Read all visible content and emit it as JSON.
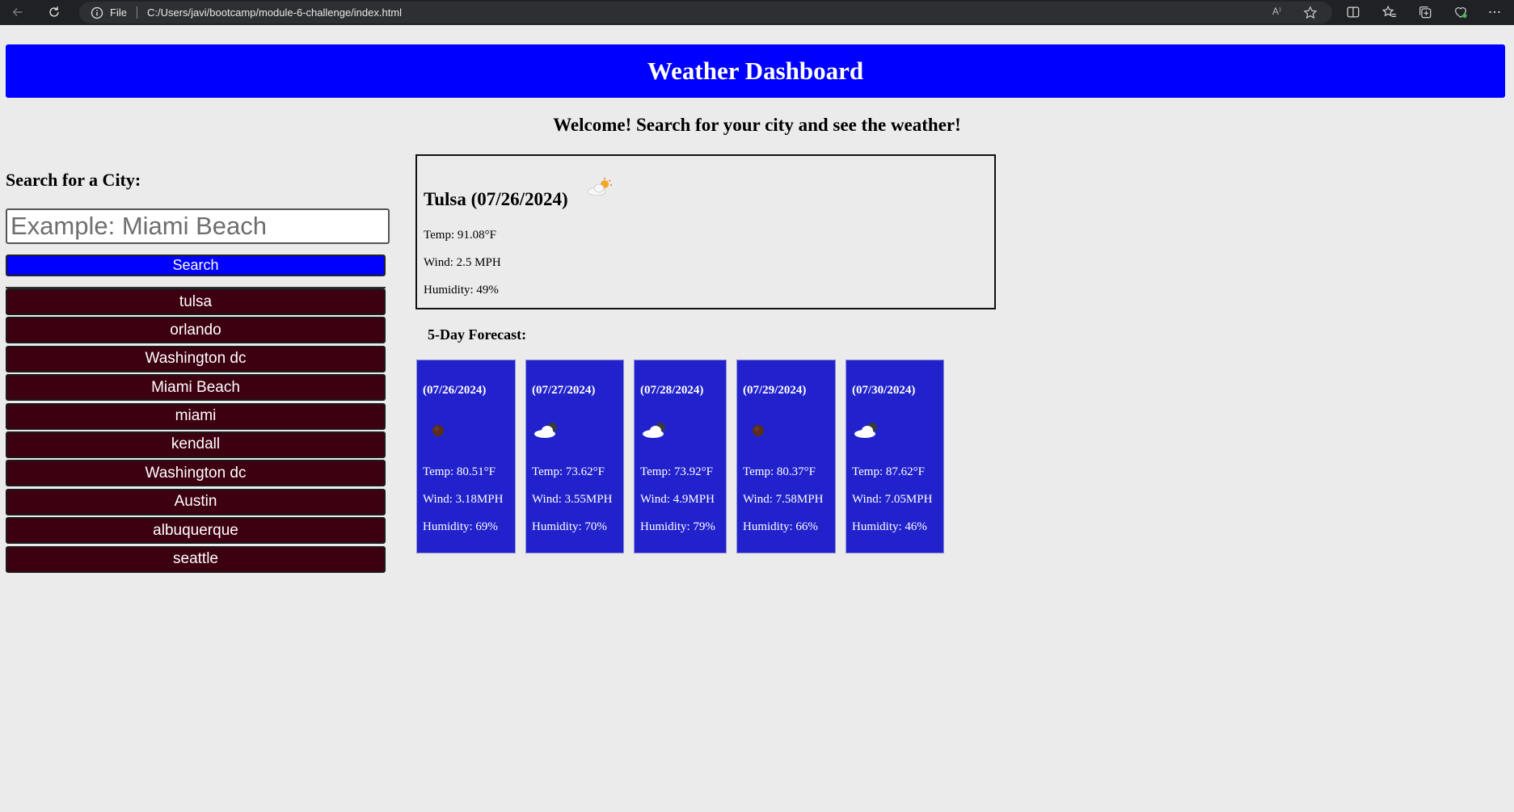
{
  "browser": {
    "file_label": "File",
    "url": "C:/Users/javi/bootcamp/module-6-challenge/index.html",
    "read_aloud_label": "A⁾"
  },
  "header": {
    "title": "Weather Dashboard"
  },
  "welcome": "Welcome! Search for your city and see the weather!",
  "search": {
    "heading": "Search for a City:",
    "placeholder": "Example: Miami Beach",
    "value": "",
    "button_label": "Search"
  },
  "history": [
    "tulsa",
    "orlando",
    "Washington dc",
    "Miami Beach",
    "miami",
    "kendall",
    "Washington dc",
    "Austin",
    "albuquerque",
    "seattle"
  ],
  "current": {
    "title": "Tulsa (07/26/2024)",
    "icon": "few-clouds-day-icon",
    "temp": "Temp: 91.08°F",
    "wind": "Wind: 2.5 MPH",
    "humidity": "Humidity: 49%"
  },
  "forecast": {
    "heading": "5-Day Forecast:",
    "days": [
      {
        "date": "(07/26/2024)",
        "icon": "clear-night-icon",
        "temp": "Temp: 80.51°F",
        "wind": "Wind: 3.18MPH",
        "humidity": "Humidity: 69%"
      },
      {
        "date": "(07/27/2024)",
        "icon": "few-clouds-night-icon",
        "temp": "Temp: 73.62°F",
        "wind": "Wind: 3.55MPH",
        "humidity": "Humidity: 70%"
      },
      {
        "date": "(07/28/2024)",
        "icon": "few-clouds-night-icon",
        "temp": "Temp: 73.92°F",
        "wind": "Wind: 4.9MPH",
        "humidity": "Humidity: 79%"
      },
      {
        "date": "(07/29/2024)",
        "icon": "clear-night-icon",
        "temp": "Temp: 80.37°F",
        "wind": "Wind: 7.58MPH",
        "humidity": "Humidity: 66%"
      },
      {
        "date": "(07/30/2024)",
        "icon": "few-clouds-night-icon",
        "temp": "Temp: 87.62°F",
        "wind": "Wind: 7.05MPH",
        "humidity": "Humidity: 46%"
      }
    ]
  },
  "colors": {
    "header_bg": "#0000ff",
    "search_button_bg": "#0000ff",
    "history_button_bg": "#3d0010",
    "forecast_card_bg": "#2222cc",
    "page_bg": "#ebebeb"
  }
}
